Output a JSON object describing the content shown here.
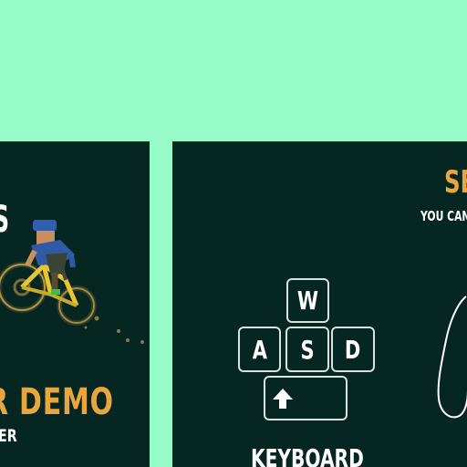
{
  "left_card": {
    "title_fragment": "S",
    "demo_title": "R DEMO",
    "demo_subtitle": "ER"
  },
  "right_card": {
    "settings_title": "SE",
    "settings_subtitle": "YOU CAN",
    "keys": {
      "w": "W",
      "a": "A",
      "s": "S",
      "d": "D"
    },
    "keyboard_label": "KEYBOARD"
  },
  "colors": {
    "background": "#96fbc7",
    "panel": "#052621",
    "accent": "#e9a63f",
    "text": "#ffffff"
  },
  "icons": {
    "space_key": "up-arrow-icon",
    "controller": "controller-outline-icon",
    "rider": "mountain-bike-rider-icon"
  }
}
